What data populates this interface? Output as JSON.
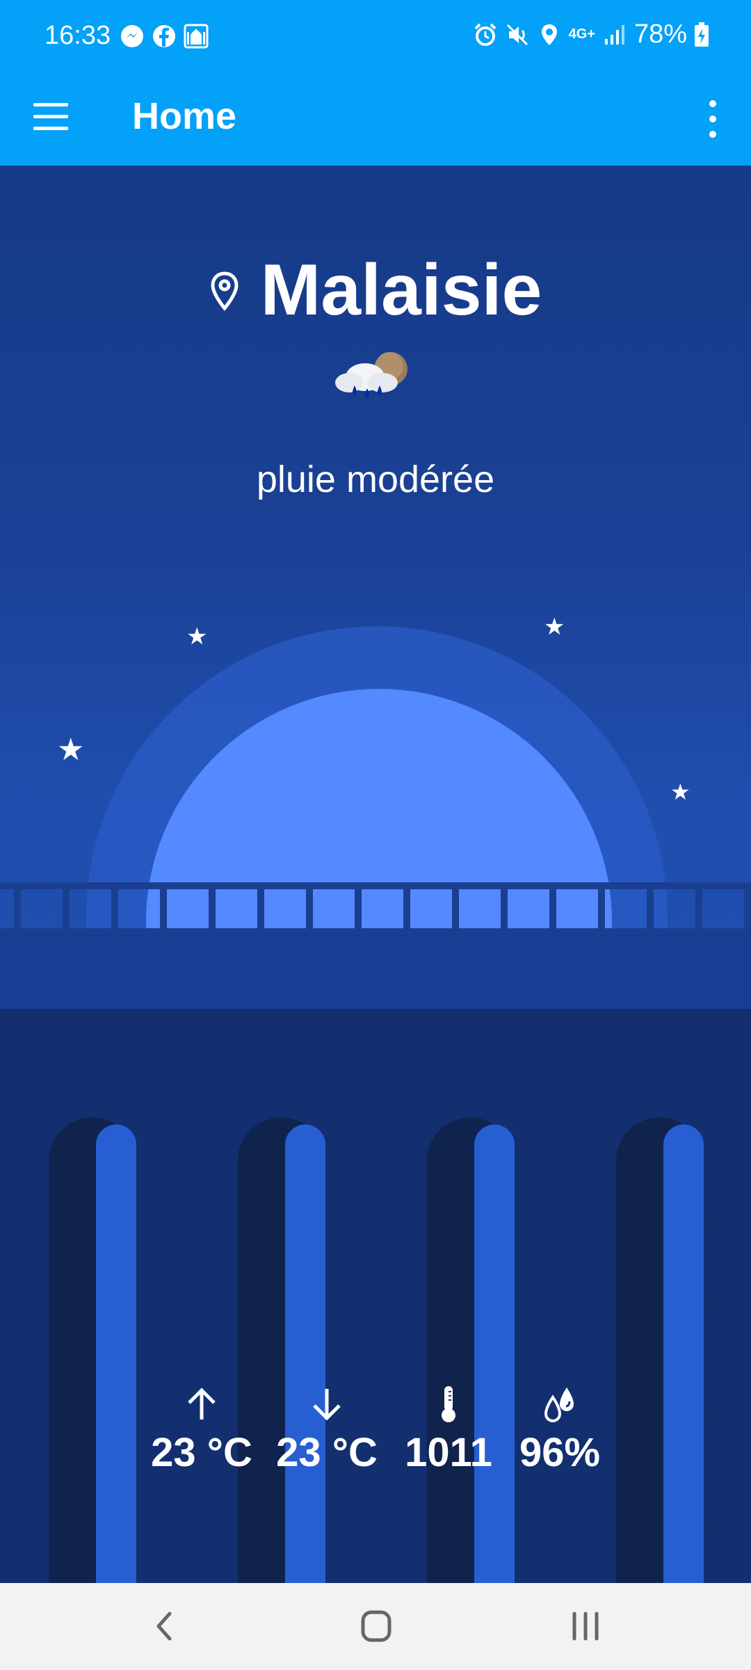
{
  "status_bar": {
    "time": "16:33",
    "battery": "78%",
    "network": "4G+",
    "left_icons": [
      "messenger-icon",
      "facebook-icon",
      "mosque-icon"
    ],
    "right_icons": [
      "alarm-icon",
      "mute-icon",
      "location-pin-icon",
      "signal-icon",
      "battery-charging-icon"
    ]
  },
  "app_bar": {
    "title": "Home",
    "menu_icon": "hamburger-menu-icon",
    "more_icon": "more-vert-icon"
  },
  "weather": {
    "location": "Malaisie",
    "location_icon": "location-pin-icon",
    "condition_icon": "rain-cloud-moon-icon",
    "condition": "pluie modérée"
  },
  "stats": {
    "max_temp": "23 °C",
    "min_temp": "23 °C",
    "pressure": "1011",
    "humidity": "96%"
  },
  "navigation": {
    "back": "back-icon",
    "home": "home-icon",
    "recents": "recents-icon"
  },
  "colors": {
    "app_bar": "#03a1f7",
    "sky_top": "#163a87",
    "moon": "#5589ff",
    "halo": "#2b5cc7",
    "pillar_dark": "#0f234d",
    "pillar_light": "#275fd3",
    "navbar": "#f2f2f2"
  }
}
